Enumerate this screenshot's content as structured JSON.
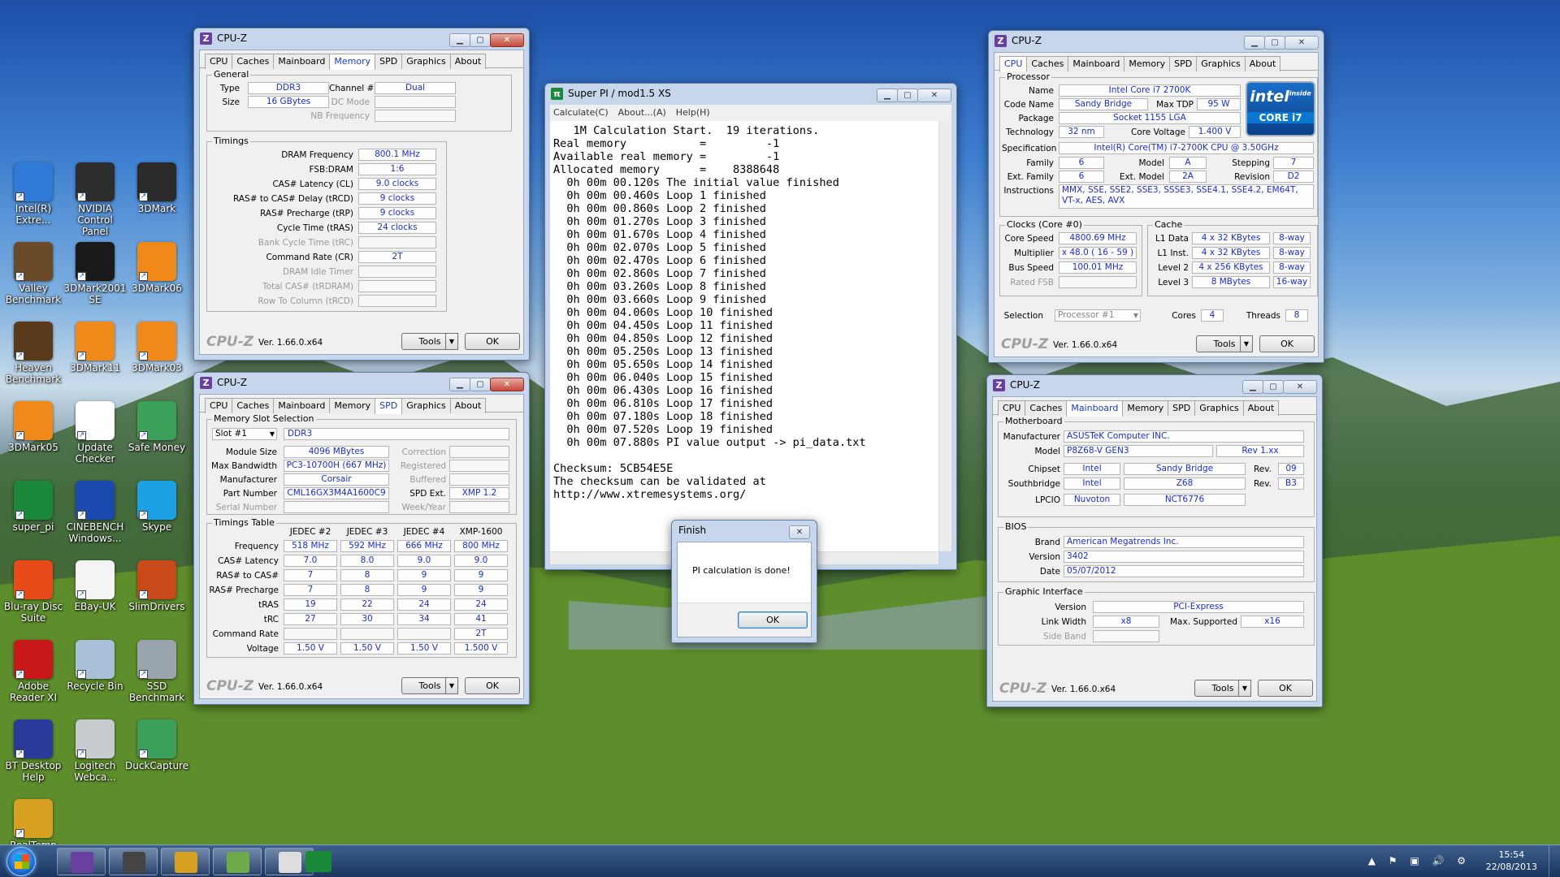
{
  "desktop": {
    "icons": [
      {
        "label": "Intel(R) Extre...",
        "color": "#2f7ad6"
      },
      {
        "label": "NVIDIA Control Panel",
        "color": "#2d2d2d"
      },
      {
        "label": "3DMark",
        "color": "#2a2a2a"
      },
      {
        "label": "Valley Benchmark",
        "color": "#6b4a2a"
      },
      {
        "label": "3DMark2001 SE",
        "color": "#1a1a1a"
      },
      {
        "label": "3DMark06",
        "color": "#ef8a1a"
      },
      {
        "label": "Heaven Benchmark",
        "color": "#5a3a1a"
      },
      {
        "label": "3DMark11",
        "color": "#ef8a1a"
      },
      {
        "label": "3DMark03",
        "color": "#ef8a1a"
      },
      {
        "label": "3DMark05",
        "color": "#ef8a1a"
      },
      {
        "label": "Update Checker",
        "color": "#ffffff"
      },
      {
        "label": "Safe Money",
        "color": "#3aa05a"
      },
      {
        "label": "super_pi",
        "color": "#1a8a3a"
      },
      {
        "label": "CINEBENCH Windows...",
        "color": "#1a4ab0"
      },
      {
        "label": "Skype",
        "color": "#1ea0e6"
      },
      {
        "label": "Blu-ray Disc Suite",
        "color": "#e84a1a"
      },
      {
        "label": "EBay-UK",
        "color": "#f4f4f4"
      },
      {
        "label": "SlimDrivers",
        "color": "#c84a1a"
      },
      {
        "label": "Adobe Reader XI",
        "color": "#c8181a"
      },
      {
        "label": "Recycle Bin",
        "color": "#a8c0d8"
      },
      {
        "label": "SSD Benchmark",
        "color": "#9aa4ae"
      },
      {
        "label": "BT Desktop Help",
        "color": "#2a3a9a"
      },
      {
        "label": "Logitech Webca...",
        "color": "#c8ccd0"
      },
      {
        "label": "DuckCapture",
        "color": "#3aa05a"
      },
      {
        "label": "RealTemp",
        "color": "#d8a020"
      }
    ]
  },
  "cpuz_memory": {
    "title": "CPU-Z",
    "tabs": [
      "CPU",
      "Caches",
      "Mainboard",
      "Memory",
      "SPD",
      "Graphics",
      "About"
    ],
    "active": "Memory",
    "general_title": "General",
    "type_label": "Type",
    "type": "DDR3",
    "size_label": "Size",
    "size": "16 GBytes",
    "channel_label": "Channel #",
    "channel": "Dual",
    "dcmode_label": "DC Mode",
    "nbfreq_label": "NB Frequency",
    "timings_title": "Timings",
    "timings": [
      {
        "label": "DRAM Frequency",
        "value": "800.1 MHz",
        "grey": false
      },
      {
        "label": "FSB:DRAM",
        "value": "1:6",
        "grey": false
      },
      {
        "label": "CAS# Latency (CL)",
        "value": "9.0 clocks",
        "grey": false
      },
      {
        "label": "RAS# to CAS# Delay (tRCD)",
        "value": "9 clocks",
        "grey": false
      },
      {
        "label": "RAS# Precharge (tRP)",
        "value": "9 clocks",
        "grey": false
      },
      {
        "label": "Cycle Time (tRAS)",
        "value": "24 clocks",
        "grey": false
      },
      {
        "label": "Bank Cycle Time (tRC)",
        "value": "",
        "grey": true
      },
      {
        "label": "Command Rate (CR)",
        "value": "2T",
        "grey": false
      },
      {
        "label": "DRAM Idle Timer",
        "value": "",
        "grey": true
      },
      {
        "label": "Total CAS# (tRDRAM)",
        "value": "",
        "grey": true
      },
      {
        "label": "Row To Column (tRCD)",
        "value": "",
        "grey": true
      }
    ],
    "logo": "CPU-Z",
    "version": "Ver. 1.66.0.x64",
    "tools": "Tools",
    "ok": "OK"
  },
  "cpuz_spd": {
    "title": "CPU-Z",
    "tabs": [
      "CPU",
      "Caches",
      "Mainboard",
      "Memory",
      "SPD",
      "Graphics",
      "About"
    ],
    "active": "SPD",
    "slot_title": "Memory Slot Selection",
    "slot": "Slot #1",
    "ddr": "DDR3",
    "rows": [
      {
        "label": "Module Size",
        "value": "4096 MBytes",
        "rlabel": "Correction",
        "rvalue": ""
      },
      {
        "label": "Max Bandwidth",
        "value": "PC3-10700H (667 MHz)",
        "rlabel": "Registered",
        "rvalue": ""
      },
      {
        "label": "Manufacturer",
        "value": "Corsair",
        "rlabel": "Buffered",
        "rvalue": ""
      },
      {
        "label": "Part Number",
        "value": "CML16GX3M4A1600C9",
        "rlabel": "SPD Ext.",
        "rvalue": "XMP 1.2"
      },
      {
        "label": "Serial Number",
        "value": "",
        "rlabel": "Week/Year",
        "rvalue": ""
      }
    ],
    "table_title": "Timings Table",
    "cols": [
      "JEDEC #2",
      "JEDEC #3",
      "JEDEC #4",
      "XMP-1600"
    ],
    "trows": [
      {
        "label": "Frequency",
        "vals": [
          "518 MHz",
          "592 MHz",
          "666 MHz",
          "800 MHz"
        ]
      },
      {
        "label": "CAS# Latency",
        "vals": [
          "7.0",
          "8.0",
          "9.0",
          "9.0"
        ]
      },
      {
        "label": "RAS# to CAS#",
        "vals": [
          "7",
          "8",
          "9",
          "9"
        ]
      },
      {
        "label": "RAS# Precharge",
        "vals": [
          "7",
          "8",
          "9",
          "9"
        ]
      },
      {
        "label": "tRAS",
        "vals": [
          "19",
          "22",
          "24",
          "24"
        ]
      },
      {
        "label": "tRC",
        "vals": [
          "27",
          "30",
          "34",
          "41"
        ]
      },
      {
        "label": "Command Rate",
        "vals": [
          "",
          "",
          "",
          "2T"
        ]
      },
      {
        "label": "Voltage",
        "vals": [
          "1.50 V",
          "1.50 V",
          "1.50 V",
          "1.500 V"
        ]
      }
    ],
    "logo": "CPU-Z",
    "version": "Ver. 1.66.0.x64",
    "tools": "Tools",
    "ok": "OK"
  },
  "superpi": {
    "title": "Super PI / mod1.5 XS",
    "menu": [
      "Calculate(C)",
      "About...(A)",
      "Help(H)"
    ],
    "output": "   1M Calculation Start.  19 iterations.\nReal memory           =         -1\nAvailable real memory =         -1\nAllocated memory      =    8388648\n  0h 00m 00.120s The initial value finished\n  0h 00m 00.460s Loop 1 finished\n  0h 00m 00.860s Loop 2 finished\n  0h 00m 01.270s Loop 3 finished\n  0h 00m 01.670s Loop 4 finished\n  0h 00m 02.070s Loop 5 finished\n  0h 00m 02.470s Loop 6 finished\n  0h 00m 02.860s Loop 7 finished\n  0h 00m 03.260s Loop 8 finished\n  0h 00m 03.660s Loop 9 finished\n  0h 00m 04.060s Loop 10 finished\n  0h 00m 04.450s Loop 11 finished\n  0h 00m 04.850s Loop 12 finished\n  0h 00m 05.250s Loop 13 finished\n  0h 00m 05.650s Loop 14 finished\n  0h 00m 06.040s Loop 15 finished\n  0h 00m 06.430s Loop 16 finished\n  0h 00m 06.810s Loop 17 finished\n  0h 00m 07.180s Loop 18 finished\n  0h 00m 07.520s Loop 19 finished\n  0h 00m 07.880s PI value output -> pi_data.txt\n\nChecksum: 5CB54E5E\nThe checksum can be validated at\nhttp://www.xtremesystems.org/"
  },
  "finish_dialog": {
    "title": "Finish",
    "message": "PI calculation is done!",
    "ok": "OK"
  },
  "cpuz_cpu": {
    "title": "CPU-Z",
    "tabs": [
      "CPU",
      "Caches",
      "Mainboard",
      "Memory",
      "SPD",
      "Graphics",
      "About"
    ],
    "active": "CPU",
    "processor_title": "Processor",
    "name_label": "Name",
    "name": "Intel Core i7 2700K",
    "codename_label": "Code Name",
    "codename": "Sandy Bridge",
    "tdp_label": "Max TDP",
    "tdp": "95 W",
    "package_label": "Package",
    "package": "Socket 1155 LGA",
    "tech_label": "Technology",
    "tech": "32 nm",
    "voltage_label": "Core Voltage",
    "voltage": "1.400 V",
    "spec_label": "Specification",
    "spec": "Intel(R) Core(TM) i7-2700K CPU @ 3.50GHz",
    "family_label": "Family",
    "family": "6",
    "model_label": "Model",
    "model": "A",
    "stepping_label": "Stepping",
    "stepping": "7",
    "extfamily_label": "Ext. Family",
    "extfamily": "6",
    "extmodel_label": "Ext. Model",
    "extmodel": "2A",
    "revision_label": "Revision",
    "revision": "D2",
    "instr_label": "Instructions",
    "instr": "MMX, SSE, SSE2, SSE3, SSSE3, SSE4.1, SSE4.2, EM64T, VT-x, AES, AVX",
    "intel_badge_top": "intel",
    "intel_badge_inside": "inside",
    "intel_badge_core": "CORE i7",
    "clocks_title": "Clocks (Core #0)",
    "corespeed_label": "Core Speed",
    "corespeed": "4800.69 MHz",
    "mult_label": "Multiplier",
    "mult": "x 48.0 ( 16 - 59 )",
    "bus_label": "Bus Speed",
    "bus": "100.01 MHz",
    "fsb_label": "Rated FSB",
    "cache_title": "Cache",
    "cache": [
      {
        "label": "L1 Data",
        "size": "4 x 32 KBytes",
        "way": "8-way"
      },
      {
        "label": "L1 Inst.",
        "size": "4 x 32 KBytes",
        "way": "8-way"
      },
      {
        "label": "Level 2",
        "size": "4 x 256 KBytes",
        "way": "8-way"
      },
      {
        "label": "Level 3",
        "size": "8 MBytes",
        "way": "16-way"
      }
    ],
    "selection_label": "Selection",
    "selection": "Processor #1",
    "cores_label": "Cores",
    "cores": "4",
    "threads_label": "Threads",
    "threads": "8",
    "logo": "CPU-Z",
    "version": "Ver. 1.66.0.x64",
    "tools": "Tools",
    "ok": "OK"
  },
  "cpuz_mainboard": {
    "title": "CPU-Z",
    "tabs": [
      "CPU",
      "Caches",
      "Mainboard",
      "Memory",
      "SPD",
      "Graphics",
      "About"
    ],
    "active": "Mainboard",
    "mb_title": "Motherboard",
    "manu_label": "Manufacturer",
    "manu": "ASUSTeK Computer INC.",
    "model_label": "Model",
    "model": "P8Z68-V GEN3",
    "rev": "Rev 1.xx",
    "chipset_label": "Chipset",
    "chipset_v": "Intel",
    "chipset": "Sandy Bridge",
    "chipset_rev_label": "Rev.",
    "chipset_rev": "09",
    "south_label": "Southbridge",
    "south_v": "Intel",
    "south": "Z68",
    "south_rev_label": "Rev.",
    "south_rev": "B3",
    "lpcio_label": "LPCIO",
    "lpcio_v": "Nuvoton",
    "lpcio": "NCT6776",
    "bios_title": "BIOS",
    "brand_label": "Brand",
    "brand": "American Megatrends Inc.",
    "ver_label": "Version",
    "bios_ver": "3402",
    "date_label": "Date",
    "date": "05/07/2012",
    "gi_title": "Graphic Interface",
    "gi_ver_label": "Version",
    "gi_ver": "PCI-Express",
    "lw_label": "Link Width",
    "lw": "x8",
    "ms_label": "Max. Supported",
    "ms": "x16",
    "sb_label": "Side Band",
    "logo": "CPU-Z",
    "version": "Ver. 1.66.0.x64",
    "tools": "Tools",
    "ok": "OK"
  },
  "taskbar": {
    "time": "15:54",
    "date": "22/08/2013"
  }
}
